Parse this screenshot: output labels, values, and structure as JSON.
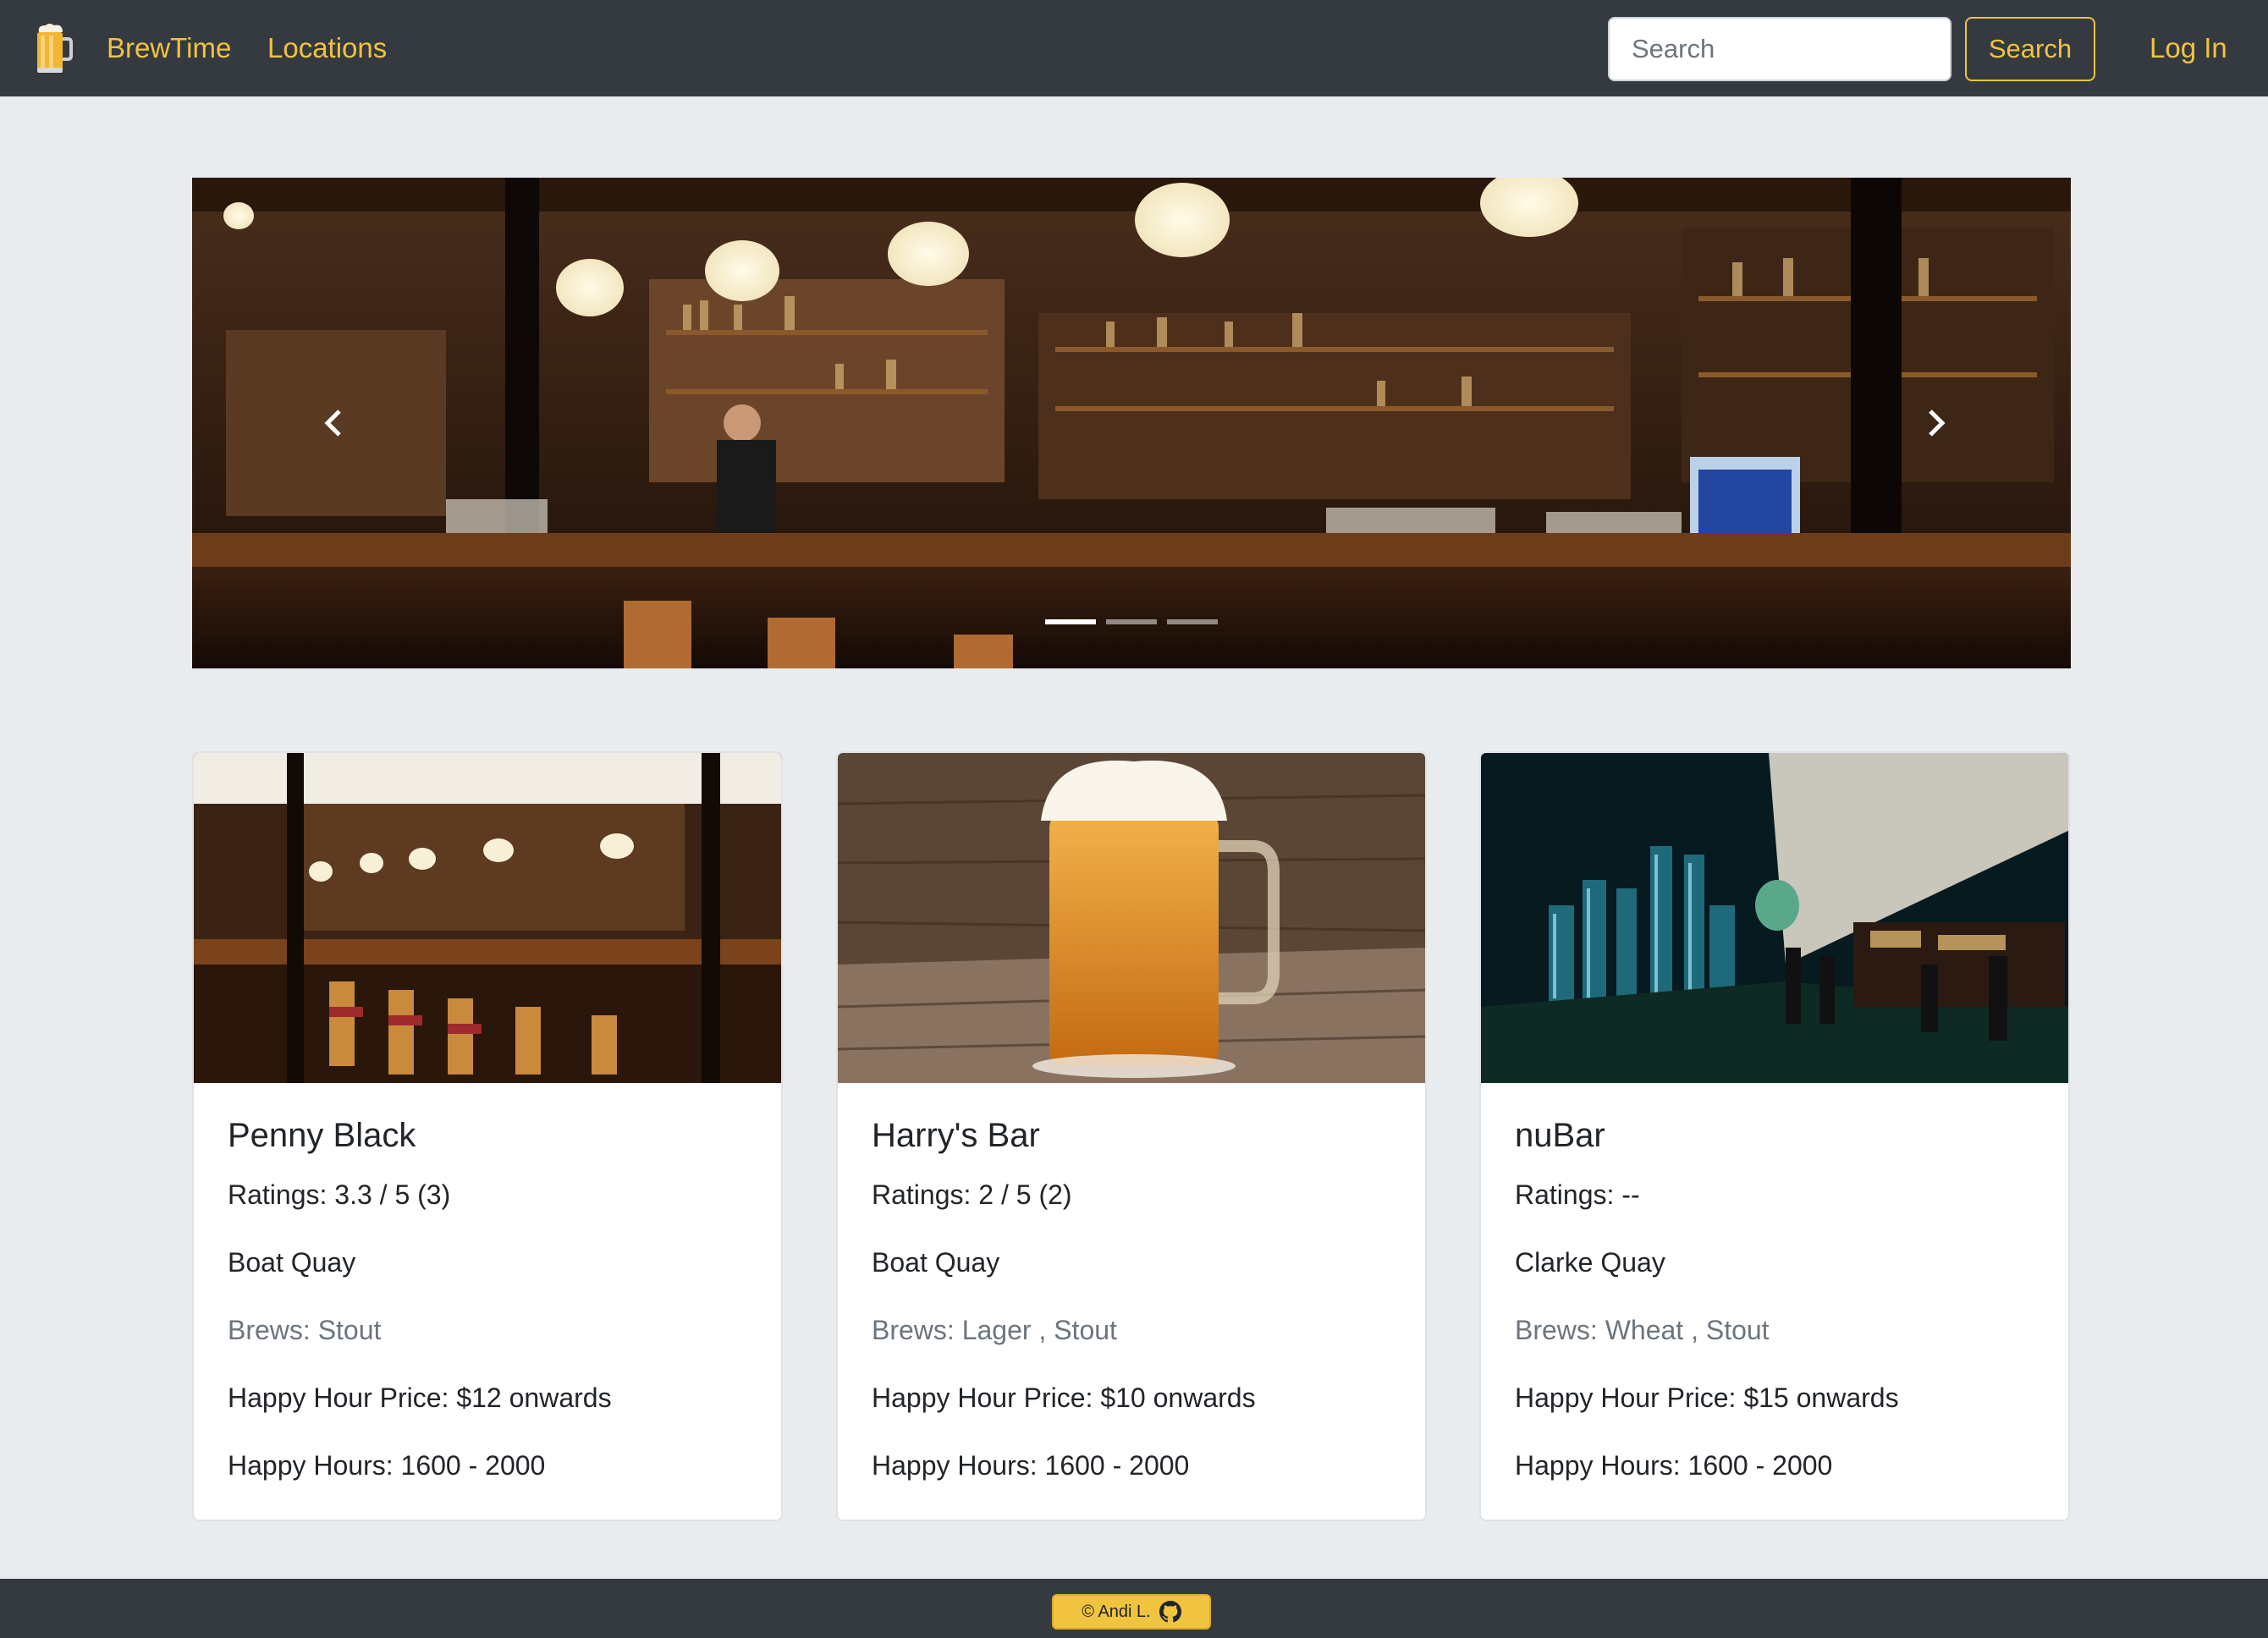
{
  "navbar": {
    "logo_icon": "beer-mug-icon",
    "brand": "BrewTime",
    "locations": "Locations",
    "search_placeholder": "Search",
    "search_button": "Search",
    "login": "Log In"
  },
  "carousel": {
    "prev_icon": "chevron-left-icon",
    "next_icon": "chevron-right-icon",
    "slide_count": 3,
    "active_slide": 1
  },
  "cards": [
    {
      "name": "Penny Black",
      "ratings": "Ratings: 3.3 / 5 (3)",
      "location": "Boat Quay",
      "brews": "Brews: Stout",
      "price": "Happy Hour Price: $12 onwards",
      "hours": "Happy Hours: 1600 - 2000"
    },
    {
      "name": "Harry's Bar",
      "ratings": "Ratings: 2 / 5 (2)",
      "location": "Boat Quay",
      "brews": "Brews: Lager , Stout",
      "price": "Happy Hour Price: $10 onwards",
      "hours": "Happy Hours: 1600 - 2000"
    },
    {
      "name": "nuBar",
      "ratings": "Ratings: --",
      "location": "Clarke Quay",
      "brews": "Brews: Wheat , Stout",
      "price": "Happy Hour Price: $15 onwards",
      "hours": "Happy Hours: 1600 - 2000"
    }
  ],
  "footer": {
    "credit": "© Andi L.",
    "github_icon": "github-icon"
  },
  "colors": {
    "navbar_bg": "#343a40",
    "accent": "#f0c43f",
    "page_bg": "#e9ecef"
  }
}
